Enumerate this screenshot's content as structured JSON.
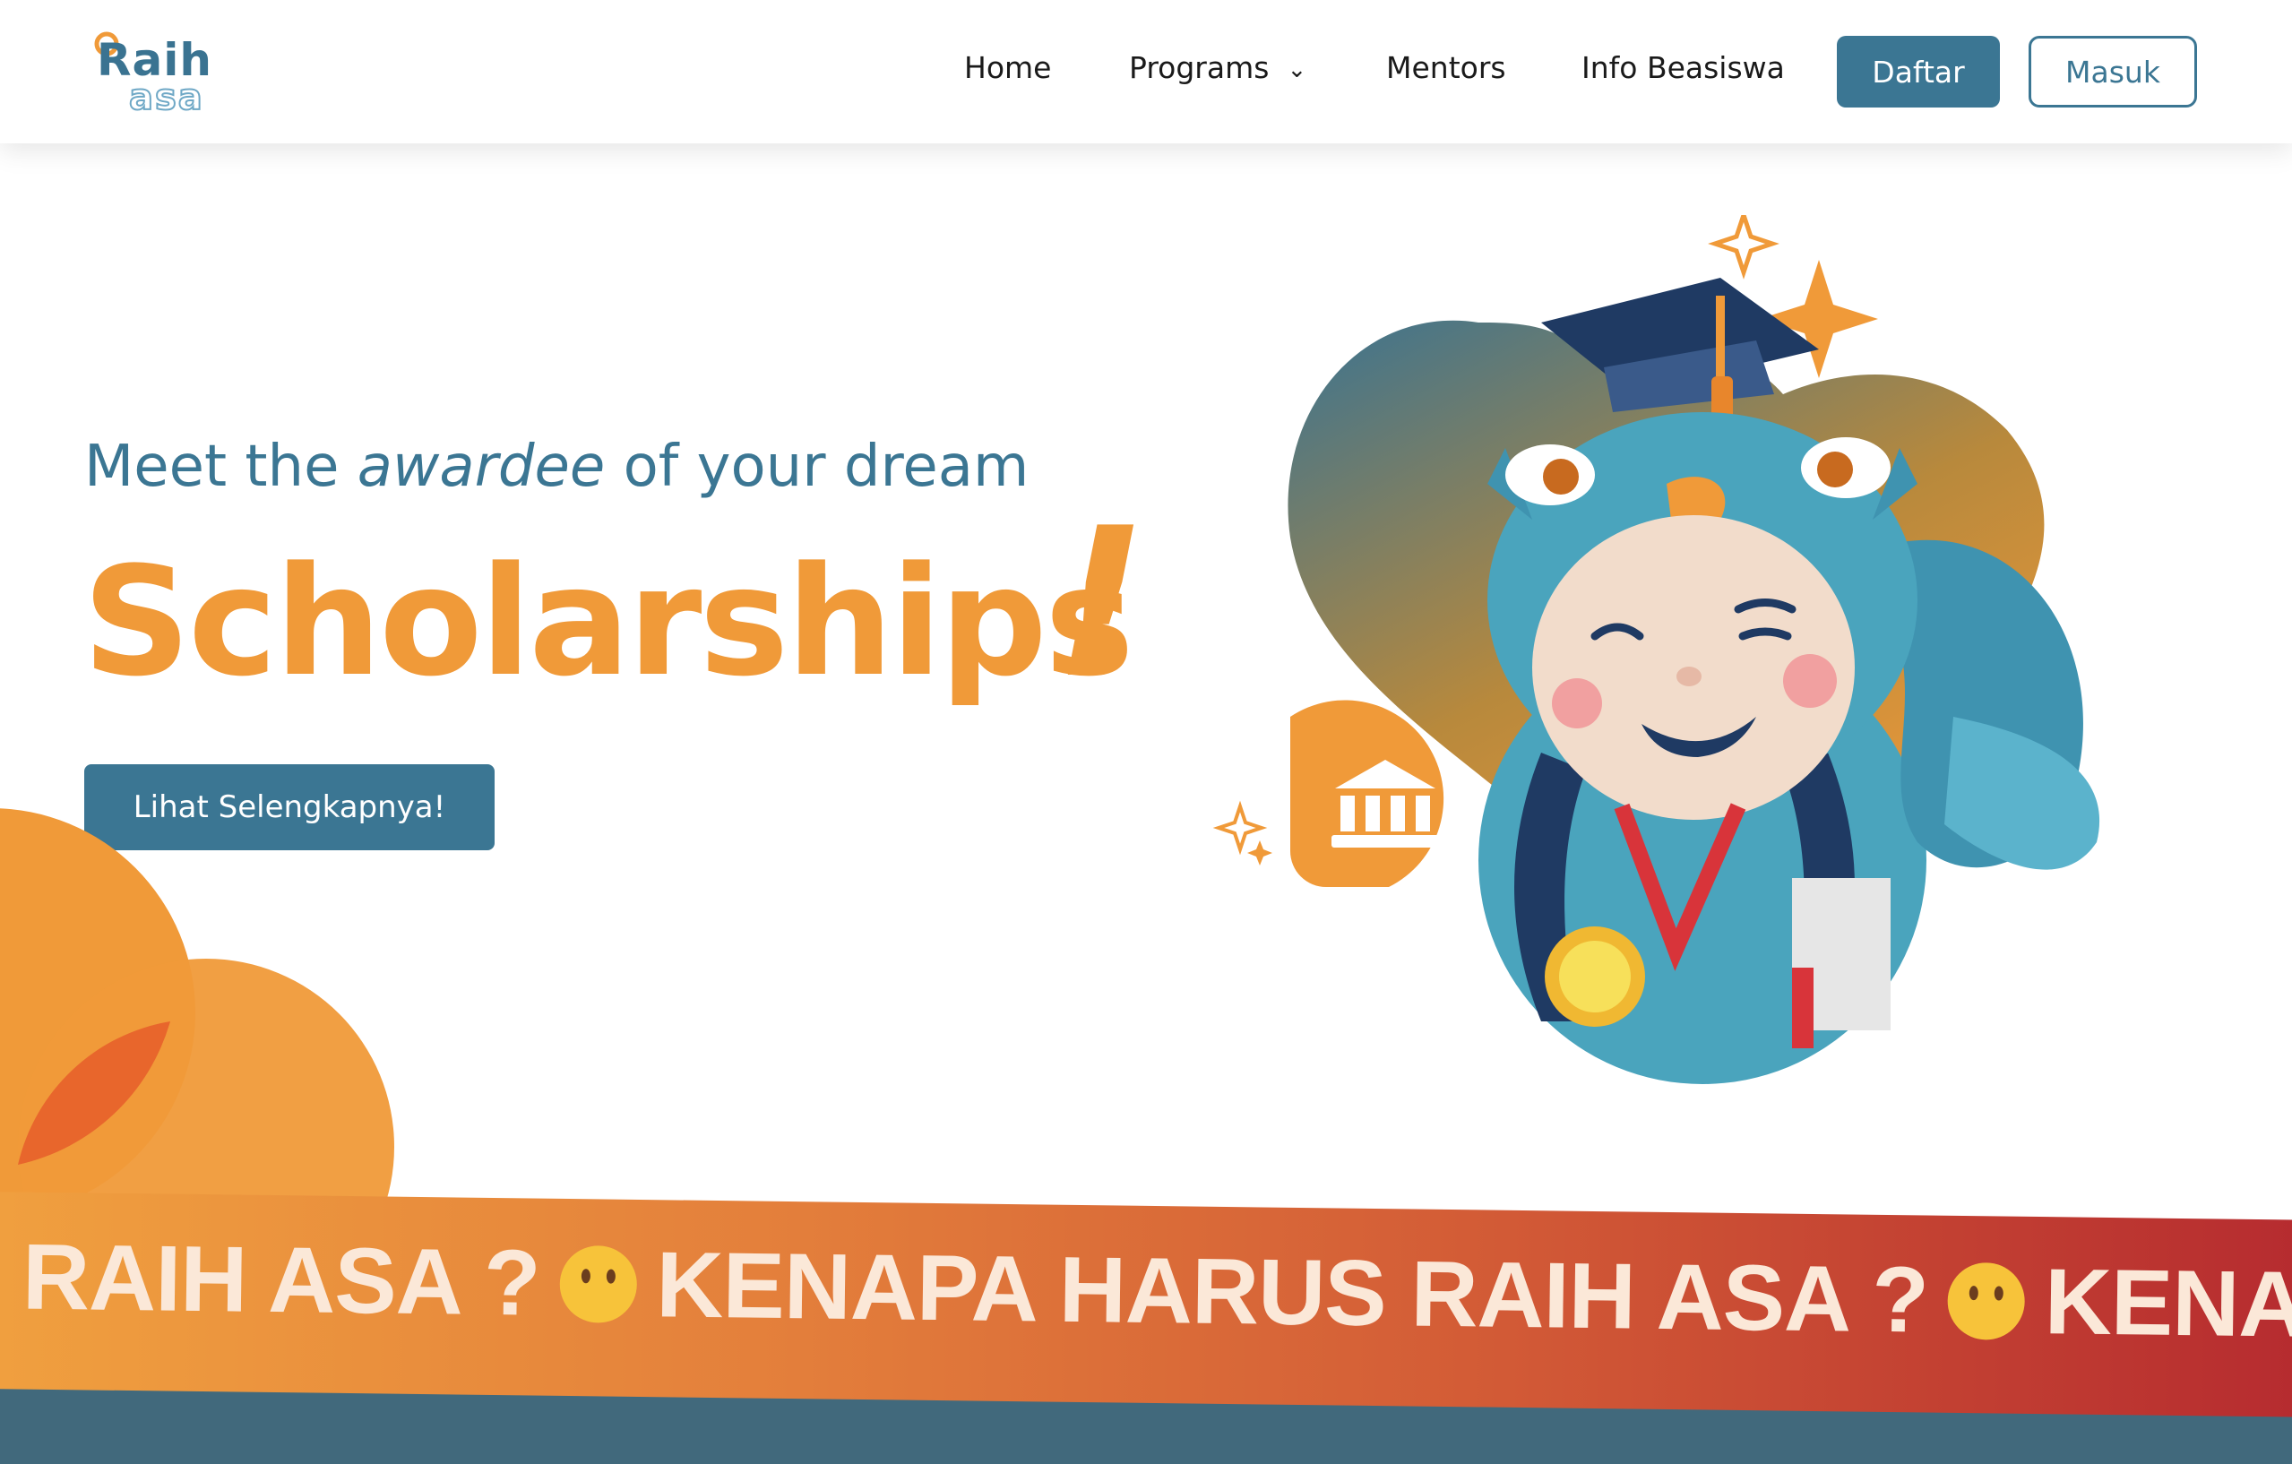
{
  "header": {
    "logo": {
      "word_top": "Raih",
      "word_bottom": "asa"
    },
    "nav": [
      {
        "label": "Home"
      },
      {
        "label": "Programs"
      },
      {
        "label": "Mentors"
      },
      {
        "label": "Info Beasiswa"
      }
    ],
    "daftar_label": "Daftar",
    "masuk_label": "Masuk"
  },
  "hero": {
    "tagline_before": "Meet the ",
    "tagline_emphasis": "awardee",
    "tagline_after": " of your dream",
    "headline": "Scholarships",
    "headline_mark": "!",
    "cta_label": "Lihat Selengkapnya!"
  },
  "ribbon": {
    "segments": [
      "S RAIH ASA ?",
      "KENAPA HARUS RAIH ASA ?",
      "KENAPA HA"
    ]
  },
  "colors": {
    "primary": "#3b7693",
    "accent": "#f09a39",
    "ribbon_end": "#b52a2f",
    "footer_band": "#41697c"
  },
  "icons": [
    "chevron-down-icon",
    "university-icon",
    "thinking-face-icon",
    "sparkle-icon"
  ]
}
